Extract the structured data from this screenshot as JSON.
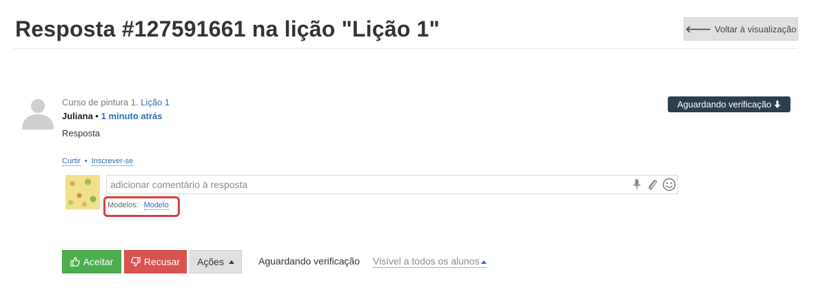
{
  "header": {
    "title": "Resposta #127591661 na lição \"Lição 1\"",
    "back_label": "Voltar à visualização"
  },
  "answer": {
    "course_prefix": "Curso de pintura 1.",
    "lesson_link": "Lição 1",
    "author": "Juliana",
    "separator": "•",
    "time_ago": "1 minuto atrás",
    "text": "Resposta",
    "status_badge": "Aguardando verificação"
  },
  "actions": {
    "like": "Curtir",
    "dot": "•",
    "subscribe": "Inscrever-se"
  },
  "comment": {
    "placeholder": "adicionar comentário à resposta",
    "templates_label": "Modelos:",
    "template_link": "Modelo"
  },
  "footer": {
    "accept": "Aceitar",
    "reject": "Recusar",
    "actions_menu": "Ações",
    "status": "Aguardando verificação",
    "visibility": "Visível a todos os alunos"
  },
  "colors": {
    "accept": "#4cae4c",
    "reject": "#d9534f",
    "badge": "#2c3e50",
    "link": "#2a6ebb",
    "highlight": "#dc3c3c"
  }
}
